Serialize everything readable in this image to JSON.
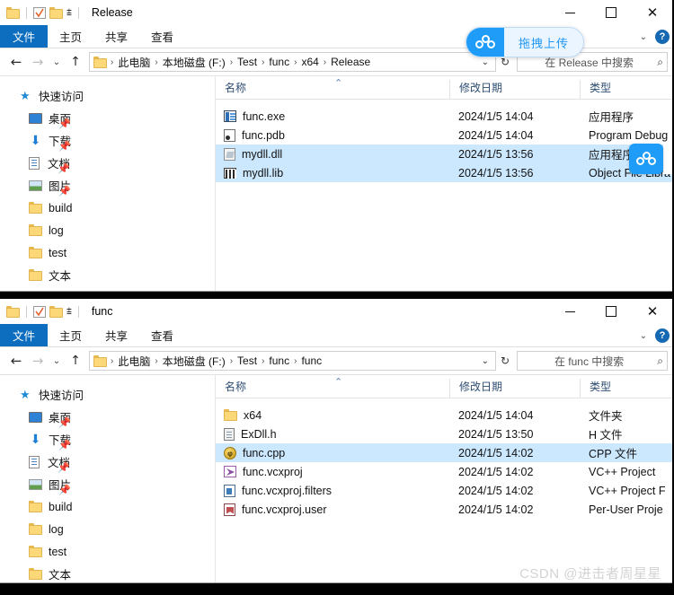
{
  "windows": [
    {
      "title": "Release",
      "quick_access_toolbar": [
        "folder-icon",
        "properties-check-icon",
        "new-folder-icon",
        "customize-dropdown-icon"
      ],
      "window_controls": {
        "minimize": "minimize-icon",
        "maximize": "maximize-icon",
        "close": "close-icon"
      },
      "ribbon_tabs": [
        "文件",
        "主页",
        "共享",
        "查看"
      ],
      "ribbon_right": {
        "collapse": "chevron-down-icon",
        "help": "?"
      },
      "nav": {
        "back": "←",
        "forward": "→",
        "recent": "⌄",
        "up": "↑",
        "breadcrumbs": [
          "此电脑",
          "本地磁盘 (F:)",
          "Test",
          "func",
          "x64",
          "Release"
        ],
        "address_dropdown": "⌄",
        "refresh": "↻",
        "search_placeholder": "在 Release 中搜索",
        "search_value": ""
      },
      "sidebar": {
        "root": {
          "label": "快速访问",
          "icon": "star-pin-icon"
        },
        "items": [
          {
            "label": "桌面",
            "icon": "desktop-icon",
            "pinned": true
          },
          {
            "label": "下载",
            "icon": "downloads-icon",
            "pinned": true
          },
          {
            "label": "文档",
            "icon": "documents-icon",
            "pinned": true
          },
          {
            "label": "图片",
            "icon": "pictures-icon",
            "pinned": true
          },
          {
            "label": "build",
            "icon": "folder-icon",
            "pinned": false
          },
          {
            "label": "log",
            "icon": "folder-icon",
            "pinned": false
          },
          {
            "label": "test",
            "icon": "folder-icon",
            "pinned": false
          },
          {
            "label": "文本",
            "icon": "folder-icon",
            "pinned": false
          }
        ]
      },
      "columns": [
        "名称",
        "修改日期",
        "类型"
      ],
      "sort": {
        "column": "名称",
        "direction": "ascending",
        "caret": "⌃"
      },
      "files": [
        {
          "name": "func.exe",
          "date": "2024/1/5 14:04",
          "type": "应用程序",
          "icon": "exe-icon",
          "selected": false
        },
        {
          "name": "func.pdb",
          "date": "2024/1/5 14:04",
          "type": "Program Debug",
          "icon": "pdb-icon",
          "selected": false
        },
        {
          "name": "mydll.dll",
          "date": "2024/1/5 13:56",
          "type": "应用程序",
          "icon": "dll-icon",
          "selected": true
        },
        {
          "name": "mydll.lib",
          "date": "2024/1/5 13:56",
          "type": "Object File Libra",
          "icon": "lib-icon",
          "selected": true
        }
      ]
    },
    {
      "title": "func",
      "quick_access_toolbar": [
        "folder-icon",
        "properties-check-icon",
        "new-folder-icon",
        "customize-dropdown-icon"
      ],
      "window_controls": {
        "minimize": "minimize-icon",
        "maximize": "maximize-icon",
        "close": "close-icon"
      },
      "ribbon_tabs": [
        "文件",
        "主页",
        "共享",
        "查看"
      ],
      "ribbon_right": {
        "collapse": "chevron-down-icon",
        "help": "?"
      },
      "nav": {
        "back": "←",
        "forward": "→",
        "recent": "⌄",
        "up": "↑",
        "breadcrumbs": [
          "此电脑",
          "本地磁盘 (F:)",
          "Test",
          "func",
          "func"
        ],
        "address_dropdown": "⌄",
        "refresh": "↻",
        "search_placeholder": "在 func 中搜索",
        "search_value": ""
      },
      "sidebar": {
        "root": {
          "label": "快速访问",
          "icon": "star-pin-icon"
        },
        "items": [
          {
            "label": "桌面",
            "icon": "desktop-icon",
            "pinned": true
          },
          {
            "label": "下载",
            "icon": "downloads-icon",
            "pinned": true
          },
          {
            "label": "文档",
            "icon": "documents-icon",
            "pinned": true
          },
          {
            "label": "图片",
            "icon": "pictures-icon",
            "pinned": true
          },
          {
            "label": "build",
            "icon": "folder-icon",
            "pinned": false
          },
          {
            "label": "log",
            "icon": "folder-icon",
            "pinned": false
          },
          {
            "label": "test",
            "icon": "folder-icon",
            "pinned": false
          },
          {
            "label": "文本",
            "icon": "folder-icon",
            "pinned": false
          }
        ]
      },
      "columns": [
        "名称",
        "修改日期",
        "类型"
      ],
      "sort": {
        "column": "名称",
        "direction": "ascending",
        "caret": "⌃"
      },
      "files": [
        {
          "name": "x64",
          "date": "2024/1/5 14:04",
          "type": "文件夹",
          "icon": "folder-icon",
          "selected": false
        },
        {
          "name": "ExDll.h",
          "date": "2024/1/5 13:50",
          "type": "H 文件",
          "icon": "h-file-icon",
          "selected": false
        },
        {
          "name": "func.cpp",
          "date": "2024/1/5 14:02",
          "type": "CPP 文件",
          "icon": "cpp-file-icon",
          "selected": true
        },
        {
          "name": "func.vcxproj",
          "date": "2024/1/5 14:02",
          "type": "VC++ Project",
          "icon": "vcxproj-icon",
          "selected": false
        },
        {
          "name": "func.vcxproj.filters",
          "date": "2024/1/5 14:02",
          "type": "VC++ Project F",
          "icon": "filters-icon",
          "selected": false
        },
        {
          "name": "func.vcxproj.user",
          "date": "2024/1/5 14:02",
          "type": "Per-User Proje",
          "icon": "user-proj-icon",
          "selected": false
        }
      ]
    }
  ],
  "overlay": {
    "upload_widget": {
      "label": "拖拽上传",
      "icon": "baidu-netdisk-icon"
    },
    "float_badge": {
      "icon": "baidu-netdisk-icon"
    }
  },
  "watermark": "CSDN @进击者周星星",
  "colors": {
    "accent": "#0d6ebf",
    "selection": "#cce8ff",
    "baidu_blue": "#1f9cf7",
    "folder_yellow": "#fcd879",
    "column_header_text": "#2d4d72"
  }
}
